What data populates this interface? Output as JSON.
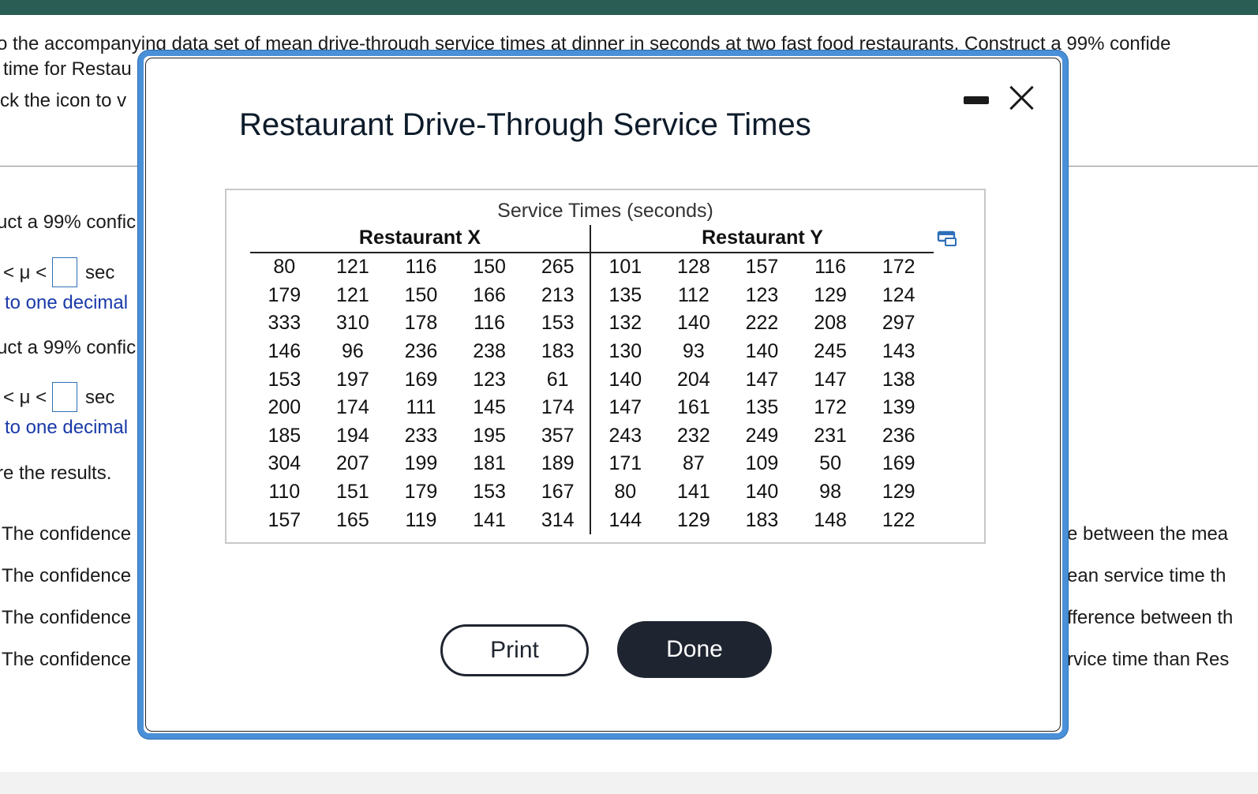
{
  "background": {
    "intro_line": "o the accompanying data set of mean drive-through service times at dinner in seconds at two fast food restaurants. Construct a 99% confide",
    "line2": "time for Restau",
    "line3": "ck the icon to v",
    "q1_label": "uct a 99% confic",
    "q1_interval": "< μ <",
    "q1_unit": "sec",
    "q1_hint": "to one decimal",
    "q2_label": "uct a 99% confic",
    "q2_interval": "< μ <",
    "q2_unit": "sec",
    "q2_hint": "to one decimal",
    "q3_label": "re the results.",
    "options_left": [
      "The confidence",
      "The confidence",
      "The confidence",
      "The confidence"
    ],
    "options_right": [
      "e between the mea",
      "ean service time th",
      "fference between th",
      "rvice time than Res"
    ]
  },
  "modal": {
    "title": "Restaurant Drive-Through Service Times",
    "caption": "Service Times (seconds)",
    "group_x": "Restaurant X",
    "group_y": "Restaurant Y",
    "print_label": "Print",
    "done_label": "Done",
    "icons": {
      "minimize": "minimize-icon",
      "close": "close-icon",
      "copy": "copy-icon"
    }
  },
  "table": {
    "restaurant_x": [
      [
        "80",
        "121",
        "116",
        "150",
        "265"
      ],
      [
        "179",
        "121",
        "150",
        "166",
        "213"
      ],
      [
        "333",
        "310",
        "178",
        "116",
        "153"
      ],
      [
        "146",
        "96",
        "236",
        "238",
        "183"
      ],
      [
        "153",
        "197",
        "169",
        "123",
        "61"
      ],
      [
        "200",
        "174",
        "111",
        "145",
        "174"
      ],
      [
        "185",
        "194",
        "233",
        "195",
        "357"
      ],
      [
        "304",
        "207",
        "199",
        "181",
        "189"
      ],
      [
        "110",
        "151",
        "179",
        "153",
        "167"
      ],
      [
        "157",
        "165",
        "119",
        "141",
        "314"
      ]
    ],
    "restaurant_y": [
      [
        "101",
        "128",
        "157",
        "116",
        "172"
      ],
      [
        "135",
        "112",
        "123",
        "129",
        "124"
      ],
      [
        "132",
        "140",
        "222",
        "208",
        "297"
      ],
      [
        "130",
        "93",
        "140",
        "245",
        "143"
      ],
      [
        "140",
        "204",
        "147",
        "147",
        "138"
      ],
      [
        "147",
        "161",
        "135",
        "172",
        "139"
      ],
      [
        "243",
        "232",
        "249",
        "231",
        "236"
      ],
      [
        "171",
        "87",
        "109",
        "50",
        "169"
      ],
      [
        "80",
        "141",
        "140",
        "98",
        "129"
      ],
      [
        "144",
        "129",
        "183",
        "148",
        "122"
      ]
    ]
  },
  "colors": {
    "topbar": "#2a5e55",
    "modal_border": "#4a90d9",
    "done_bg": "#1f2530",
    "link_blue": "#1a3aa8"
  }
}
